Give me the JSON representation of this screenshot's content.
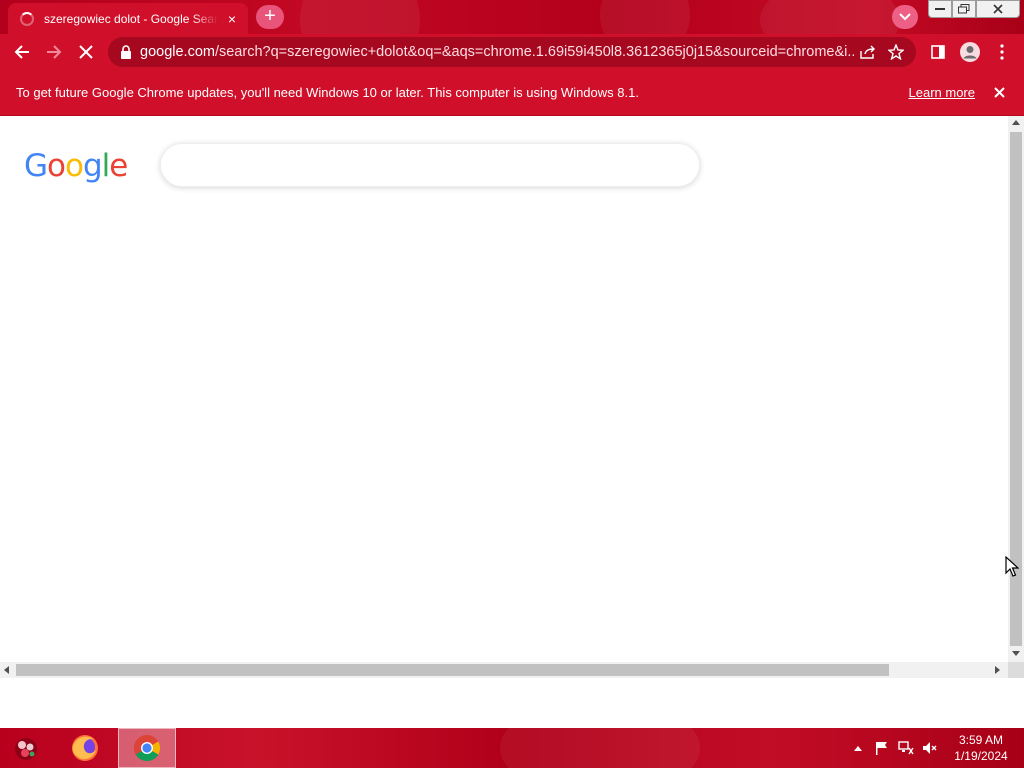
{
  "browser": {
    "tab": {
      "title": "szeregowiec dolot - Google Search",
      "close_glyph": "×"
    },
    "new_tab_glyph": "+",
    "url": {
      "host": "google.com",
      "rest": "/search?q=szeregowiec+dolot&oq=&aqs=chrome.1.69i59i450l8.3612365j0j15&sourceid=chrome&i..."
    },
    "accent_color": "#d0102a"
  },
  "infobar": {
    "message": "To get future Google Chrome updates, you'll need Windows 10 or later. This computer is using Windows 8.1.",
    "learn_more": "Learn more"
  },
  "page": {
    "logo_letters": [
      "G",
      "o",
      "o",
      "g",
      "l",
      "e"
    ],
    "logo_colors": [
      "#4285f4",
      "#ea4335",
      "#fbbc05",
      "#4285f4",
      "#34a853",
      "#ea4335"
    ],
    "search_value": ""
  },
  "taskbar": {
    "apps": [
      "start-orb-icon",
      "firefox-icon",
      "chrome-icon"
    ],
    "clock_time": "3:59 AM",
    "clock_date": "1/19/2024"
  }
}
